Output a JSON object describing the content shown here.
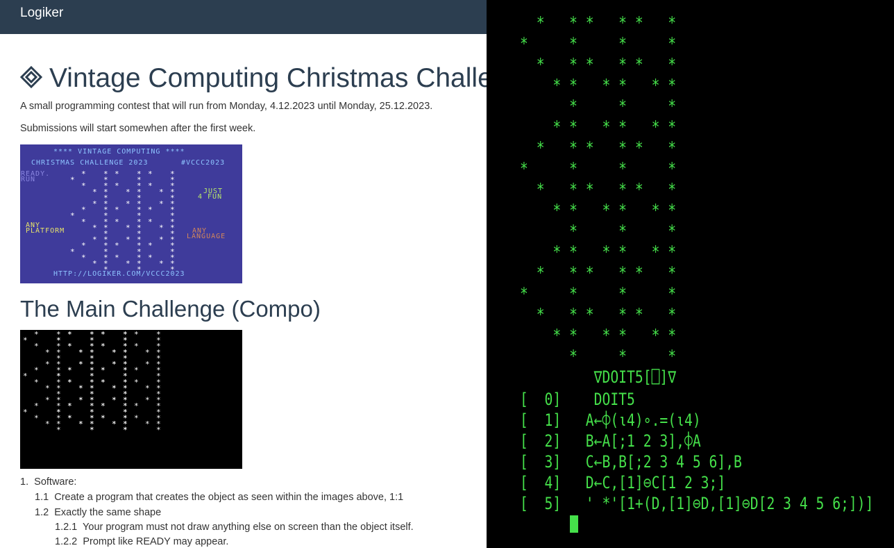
{
  "navbar": {
    "brand": "Logiker"
  },
  "page": {
    "title": "Vintage Computing Christmas Challe",
    "intro": "A small programming contest that will run from Monday, 4.12.2023 until Monday, 25.12.2023.",
    "submissions": "Submissions will start somewhen after the first week.",
    "banner": {
      "line1": "**** VINTAGE COMPUTING ****",
      "line2": "CHRISTMAS CHALLENGE 2023",
      "hashtag": "#VCCC2023",
      "ready": "READY.",
      "run": "RUN",
      "just": "JUST",
      "fun": "4 FUN",
      "any1": "ANY",
      "platform": "PLATFORM",
      "any2": "ANY",
      "language": "LANGUAGE",
      "url": "HTTP://LOGIKER.COM/VCCC2023"
    },
    "section_title": "The Main Challenge (Compo)",
    "list": {
      "item1": {
        "num": "1.",
        "text": "Software:"
      },
      "item11": {
        "num": "1.1",
        "text": "Create a program that creates the object as seen within the images above, 1:1"
      },
      "item12": {
        "num": "1.2",
        "text": "Exactly the same shape"
      },
      "item121": {
        "num": "1.2.1",
        "text": "Your program must not draw anything else on screen than the object itself."
      },
      "item122": {
        "num": "1.2.2",
        "text": "Prompt like READY may appear."
      }
    }
  },
  "terminal": {
    "lines": [
      "  *   * *   * *   *",
      "*     *     *     *",
      "  *   * *   * *   *",
      "    * *   * *   * *",
      "      *     *     *",
      "    * *   * *   * *",
      "  *   * *   * *   *",
      "*     *     *     *",
      "  *   * *   * *   *",
      "    * *   * *   * *",
      "      *     *     *",
      "    * *   * *   * *",
      "  *   * *   * *   *",
      "*     *     *     *",
      "  *   * *   * *   *",
      "    * *   * *   * *",
      "      *     *     *",
      "         ∇DOIT5[⎕]∇",
      "[  0]    DOIT5",
      "[  1]   A←⌽(ι4)∘.=(ι4)",
      "[  2]   B←A[;1 2 3],⌽A",
      "[  3]   C←B,B[;2 3 4 5 6],B",
      "[  4]   D←C,[1]⊖C[1 2 3;]",
      "[  5]   ' *'[1+(D,[1]⊖D,[1]⊖D[2 3 4 5 6;])]"
    ]
  },
  "colors": {
    "navbar": "#2c3e50",
    "terminal_text": "#45e04a",
    "banner_bg": "#3f3b9b"
  }
}
